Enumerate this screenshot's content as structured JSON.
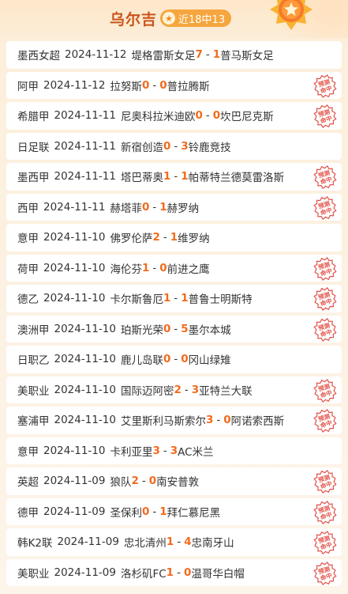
{
  "header": {
    "name": "乌尔吉",
    "record": "近18中13",
    "star_glyph": "★",
    "accent": "#c9531b",
    "pill_color": "#f6a63e"
  },
  "stamp": {
    "line1": "预测",
    "line2": "命中",
    "color": "#e2534a"
  },
  "matches": [
    {
      "league": "墨西女超",
      "date": "2024-11-12",
      "home": "堤格雷斯女足",
      "hs": "7",
      "as": "1",
      "away": "普马斯女足",
      "hit": false
    },
    {
      "league": "阿甲",
      "date": "2024-11-12",
      "home": "拉努斯",
      "hs": "0",
      "as": "0",
      "away": "普拉腾斯",
      "hit": true
    },
    {
      "league": "希腊甲",
      "date": "2024-11-11",
      "home": "尼奥科拉米迪欧",
      "hs": "0",
      "as": "0",
      "away": "坎巴尼克斯",
      "hit": true
    },
    {
      "league": "日足联",
      "date": "2024-11-11",
      "home": "新宿创造",
      "hs": "0",
      "as": "3",
      "away": "铃鹿竞技",
      "hit": false
    },
    {
      "league": "墨西甲",
      "date": "2024-11-11",
      "home": "塔巴蒂奥",
      "hs": "1",
      "as": "1",
      "away": "帕蒂特兰德莫雷洛斯",
      "hit": true
    },
    {
      "league": "西甲",
      "date": "2024-11-11",
      "home": "赫塔菲",
      "hs": "0",
      "as": "1",
      "away": "赫罗纳",
      "hit": true
    },
    {
      "league": "意甲",
      "date": "2024-11-10",
      "home": "佛罗伦萨",
      "hs": "2",
      "as": "1",
      "away": "维罗纳",
      "hit": false
    },
    {
      "league": "荷甲",
      "date": "2024-11-10",
      "home": "海伦芬",
      "hs": "1",
      "as": "0",
      "away": "前进之鹰",
      "hit": true
    },
    {
      "league": "德乙",
      "date": "2024-11-10",
      "home": "卡尔斯鲁厄",
      "hs": "1",
      "as": "1",
      "away": "普鲁士明斯特",
      "hit": true
    },
    {
      "league": "澳洲甲",
      "date": "2024-11-10",
      "home": "珀斯光荣",
      "hs": "0",
      "as": "5",
      "away": "墨尔本城",
      "hit": true
    },
    {
      "league": "日职乙",
      "date": "2024-11-10",
      "home": "鹿儿岛联",
      "hs": "0",
      "as": "0",
      "away": "冈山绿雉",
      "hit": false
    },
    {
      "league": "美职业",
      "date": "2024-11-10",
      "home": "国际迈阿密",
      "hs": "2",
      "as": "3",
      "away": "亚特兰大联",
      "hit": true
    },
    {
      "league": "塞浦甲",
      "date": "2024-11-10",
      "home": "艾里斯利马斯索尔",
      "hs": "3",
      "as": "0",
      "away": "阿诺索西斯",
      "hit": true
    },
    {
      "league": "意甲",
      "date": "2024-11-10",
      "home": "卡利亚里",
      "hs": "3",
      "as": "3",
      "away": "AC米兰",
      "hit": false
    },
    {
      "league": "英超",
      "date": "2024-11-09",
      "home": "狼队",
      "hs": "2",
      "as": "0",
      "away": "南安普敦",
      "hit": true
    },
    {
      "league": "德甲",
      "date": "2024-11-09",
      "home": "圣保利",
      "hs": "0",
      "as": "1",
      "away": "拜仁慕尼黑",
      "hit": true
    },
    {
      "league": "韩K2联",
      "date": "2024-11-09",
      "home": "忠北清州",
      "hs": "1",
      "as": "4",
      "away": "忠南牙山",
      "hit": true
    },
    {
      "league": "美职业",
      "date": "2024-11-09",
      "home": "洛杉矶FC",
      "hs": "1",
      "as": "0",
      "away": "温哥华白帽",
      "hit": true
    }
  ]
}
